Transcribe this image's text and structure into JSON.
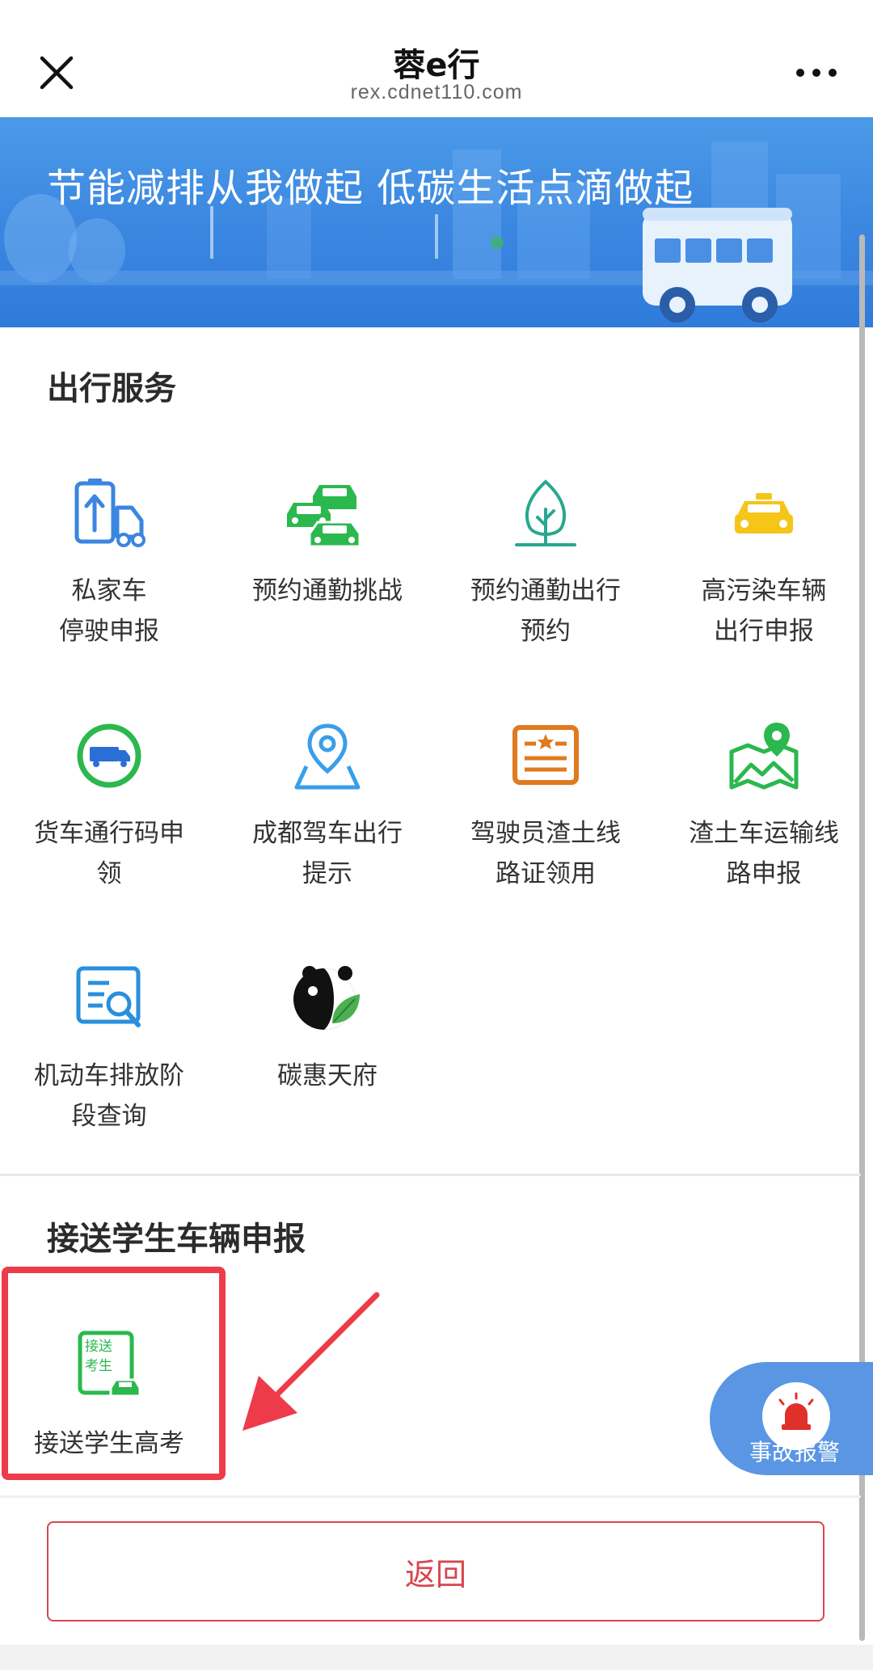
{
  "nav": {
    "title": "蓉e行",
    "url": "rex.cdnet110.com"
  },
  "banner": {
    "slogan": "节能减排从我做起 低碳生活点滴做起"
  },
  "sections": {
    "travel": {
      "title": "出行服务"
    },
    "student": {
      "title": "接送学生车辆申报"
    }
  },
  "services": [
    {
      "line1": "私家车",
      "line2": "停驶申报"
    },
    {
      "line1": "预约通勤挑战",
      "line2": ""
    },
    {
      "line1": "预约通勤出行",
      "line2": "预约"
    },
    {
      "line1": "高污染车辆",
      "line2": "出行申报"
    },
    {
      "line1": "货车通行码申",
      "line2": "领"
    },
    {
      "line1": "成都驾车出行",
      "line2": "提示"
    },
    {
      "line1": "驾驶员渣土线",
      "line2": "路证领用"
    },
    {
      "line1": "渣土车运输线",
      "line2": "路申报"
    },
    {
      "line1": "机动车排放阶",
      "line2": "段查询"
    },
    {
      "line1": "碳惠天府",
      "line2": ""
    }
  ],
  "student_service": {
    "label": "接送学生高考",
    "icon_text1": "接送",
    "icon_text2": "考生"
  },
  "alert": {
    "label": "事故报警"
  },
  "back_button": {
    "label": "返回"
  },
  "colors": {
    "primary_blue": "#3a86e0",
    "green": "#2bb84e",
    "red": "#d9454f",
    "highlight": "#ee3b4a"
  },
  "icons": [
    "close-icon",
    "more-icon",
    "battery-truck-icon",
    "cars-icon",
    "leaf-icon",
    "taxi-icon",
    "truck-badge-icon",
    "location-pin-icon",
    "certificate-icon",
    "map-pin-icon",
    "search-doc-icon",
    "panda-leaf-icon",
    "student-car-icon",
    "alarm-icon",
    "arrow-icon"
  ]
}
